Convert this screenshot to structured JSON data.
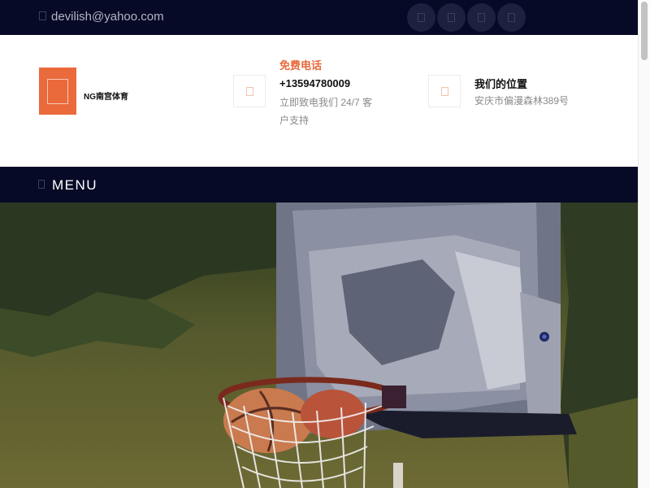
{
  "topbar": {
    "email": "devilish@yahoo.com",
    "email_icon": "envelope-icon",
    "social_icons": [
      "facebook-icon",
      "twitter-icon",
      "instagram-icon",
      "linkedin-icon"
    ]
  },
  "header": {
    "brand_name": "NG南宫体育",
    "logo_icon": "logo-icon",
    "phone": {
      "icon": "phone-icon",
      "title": "免费电话",
      "number": "+13594780009",
      "description": "立即致电我们 24/7 客户支持"
    },
    "location": {
      "icon": "map-pin-icon",
      "title": "我们的位置",
      "address": "安庆市偏漫森林389号"
    }
  },
  "nav": {
    "menu_icon": "menu-bars-icon",
    "menu_label": "MENU"
  },
  "hero": {
    "image": "basketball-hoop-photo"
  },
  "colors": {
    "dark_navy": "#060a26",
    "accent_orange": "#ea6a3c",
    "muted_text": "#8a8a8a"
  }
}
